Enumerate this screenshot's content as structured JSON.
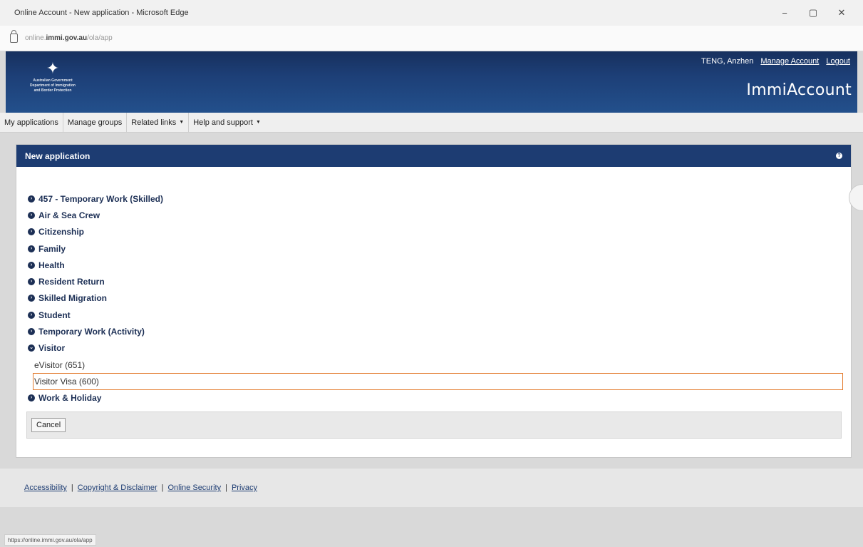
{
  "window": {
    "title": "Online Account - New application - Microsoft Edge",
    "minimize": "−",
    "restore": "▢",
    "close": "✕"
  },
  "address_bar": {
    "url_prefix": "online.",
    "url_domain": "immi.gov.au",
    "url_path": "/ola/app"
  },
  "header": {
    "gov_lines": [
      "Australian Government",
      "Department of Immigration",
      "and Border Protection"
    ],
    "user_name": "TENG, Anzhen",
    "manage_account": "Manage Account",
    "logout": "Logout",
    "brand": "ImmiAccount"
  },
  "nav": {
    "items": [
      {
        "label": "My applications",
        "dropdown": false
      },
      {
        "label": "Manage groups",
        "dropdown": false
      },
      {
        "label": "Related links",
        "dropdown": true
      },
      {
        "label": "Help and support",
        "dropdown": true
      }
    ]
  },
  "panel": {
    "title": "New application",
    "help": "?",
    "categories": [
      {
        "label": "457 - Temporary Work (Skilled)",
        "expanded": false
      },
      {
        "label": "Air & Sea Crew",
        "expanded": false
      },
      {
        "label": "Citizenship",
        "expanded": false
      },
      {
        "label": "Family",
        "expanded": false
      },
      {
        "label": "Health",
        "expanded": false
      },
      {
        "label": "Resident Return",
        "expanded": false
      },
      {
        "label": "Skilled Migration",
        "expanded": false
      },
      {
        "label": "Student",
        "expanded": false
      },
      {
        "label": "Temporary Work (Activity)",
        "expanded": false
      },
      {
        "label": "Visitor",
        "expanded": true
      },
      {
        "label": "eVisitor (651)",
        "sub": true
      },
      {
        "label": "Visitor Visa (600)",
        "sub": true,
        "selected": true
      },
      {
        "label": "Work & Holiday",
        "expanded": false
      }
    ],
    "cancel_label": "Cancel"
  },
  "footer": {
    "links": [
      "Accessibility",
      "Copyright & Disclaimer",
      "Online Security",
      "Privacy"
    ]
  },
  "status_bar": {
    "url": "https://online.immi.gov.au/ola/app"
  },
  "colors": {
    "header_blue": "#1d3c72",
    "selection_orange": "#e37b2e"
  }
}
